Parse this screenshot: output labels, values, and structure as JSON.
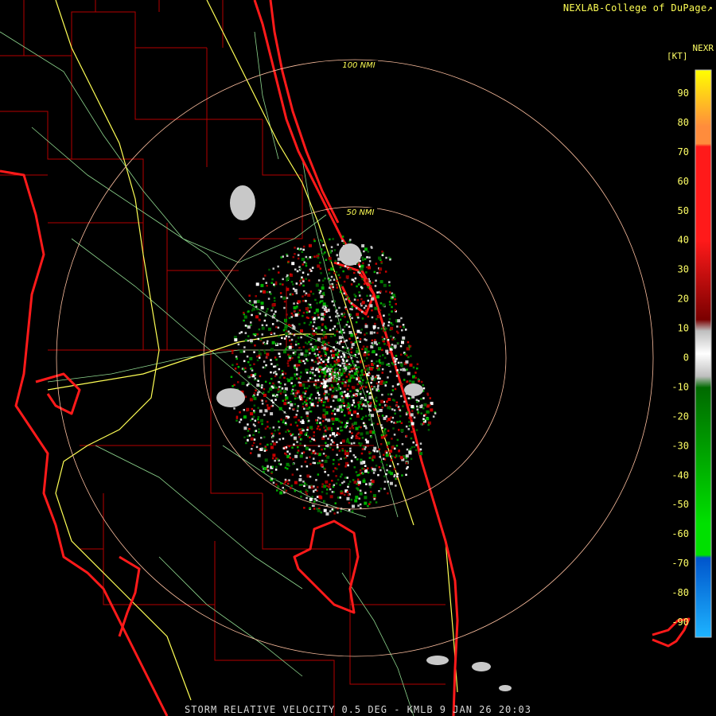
{
  "header": {
    "credit": "NEXLAB-College of DuPage",
    "credit_icon": "external-link-icon"
  },
  "footer": {
    "product": "STORM RELATIVE VELOCITY 0.5 DEG - KMLB 9 JAN 26 20:03"
  },
  "range_rings": [
    {
      "label": "50 NMI"
    },
    {
      "label": "100 NMI"
    }
  ],
  "color_scale": {
    "title": "NEXR",
    "unit": "[KT]",
    "ticks": [
      "90",
      "80",
      "70",
      "60",
      "50",
      "40",
      "30",
      "20",
      "10",
      "0",
      "-10",
      "-20",
      "-30",
      "-40",
      "-50",
      "-60",
      "-70",
      "-80",
      "-90"
    ],
    "colors": {
      "top": "#ffff00",
      "orange": "#ff8c3c",
      "red_bright": "#ff1a1a",
      "red_dark": "#7a0000",
      "gray": "#bfbfbf",
      "green_dark": "#006a00",
      "green_bright": "#00e000",
      "blue_dark": "#0055cc",
      "blue_bright": "#1eb4ff"
    }
  },
  "map_colors": {
    "coast": "#ff1a1a",
    "county": "#b40000",
    "highway": "#ffff55",
    "road": "#8fd88f",
    "ring": "#ffc0a0"
  }
}
